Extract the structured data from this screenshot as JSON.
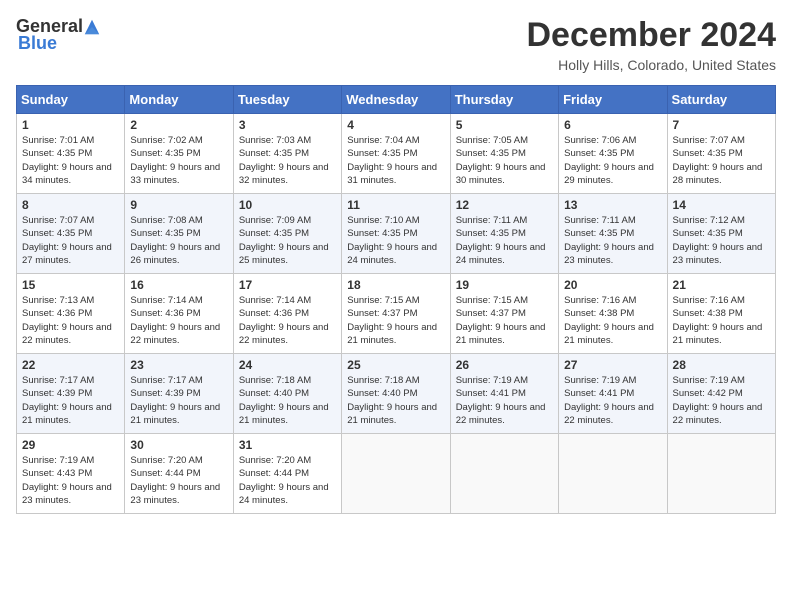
{
  "header": {
    "logo_general": "General",
    "logo_blue": "Blue",
    "month_title": "December 2024",
    "location": "Holly Hills, Colorado, United States"
  },
  "calendar": {
    "days_of_week": [
      "Sunday",
      "Monday",
      "Tuesday",
      "Wednesday",
      "Thursday",
      "Friday",
      "Saturday"
    ],
    "weeks": [
      [
        {
          "day": "1",
          "sunrise": "7:01 AM",
          "sunset": "4:35 PM",
          "daylight": "9 hours and 34 minutes."
        },
        {
          "day": "2",
          "sunrise": "7:02 AM",
          "sunset": "4:35 PM",
          "daylight": "9 hours and 33 minutes."
        },
        {
          "day": "3",
          "sunrise": "7:03 AM",
          "sunset": "4:35 PM",
          "daylight": "9 hours and 32 minutes."
        },
        {
          "day": "4",
          "sunrise": "7:04 AM",
          "sunset": "4:35 PM",
          "daylight": "9 hours and 31 minutes."
        },
        {
          "day": "5",
          "sunrise": "7:05 AM",
          "sunset": "4:35 PM",
          "daylight": "9 hours and 30 minutes."
        },
        {
          "day": "6",
          "sunrise": "7:06 AM",
          "sunset": "4:35 PM",
          "daylight": "9 hours and 29 minutes."
        },
        {
          "day": "7",
          "sunrise": "7:07 AM",
          "sunset": "4:35 PM",
          "daylight": "9 hours and 28 minutes."
        }
      ],
      [
        {
          "day": "8",
          "sunrise": "7:07 AM",
          "sunset": "4:35 PM",
          "daylight": "9 hours and 27 minutes."
        },
        {
          "day": "9",
          "sunrise": "7:08 AM",
          "sunset": "4:35 PM",
          "daylight": "9 hours and 26 minutes."
        },
        {
          "day": "10",
          "sunrise": "7:09 AM",
          "sunset": "4:35 PM",
          "daylight": "9 hours and 25 minutes."
        },
        {
          "day": "11",
          "sunrise": "7:10 AM",
          "sunset": "4:35 PM",
          "daylight": "9 hours and 24 minutes."
        },
        {
          "day": "12",
          "sunrise": "7:11 AM",
          "sunset": "4:35 PM",
          "daylight": "9 hours and 24 minutes."
        },
        {
          "day": "13",
          "sunrise": "7:11 AM",
          "sunset": "4:35 PM",
          "daylight": "9 hours and 23 minutes."
        },
        {
          "day": "14",
          "sunrise": "7:12 AM",
          "sunset": "4:35 PM",
          "daylight": "9 hours and 23 minutes."
        }
      ],
      [
        {
          "day": "15",
          "sunrise": "7:13 AM",
          "sunset": "4:36 PM",
          "daylight": "9 hours and 22 minutes."
        },
        {
          "day": "16",
          "sunrise": "7:14 AM",
          "sunset": "4:36 PM",
          "daylight": "9 hours and 22 minutes."
        },
        {
          "day": "17",
          "sunrise": "7:14 AM",
          "sunset": "4:36 PM",
          "daylight": "9 hours and 22 minutes."
        },
        {
          "day": "18",
          "sunrise": "7:15 AM",
          "sunset": "4:37 PM",
          "daylight": "9 hours and 21 minutes."
        },
        {
          "day": "19",
          "sunrise": "7:15 AM",
          "sunset": "4:37 PM",
          "daylight": "9 hours and 21 minutes."
        },
        {
          "day": "20",
          "sunrise": "7:16 AM",
          "sunset": "4:38 PM",
          "daylight": "9 hours and 21 minutes."
        },
        {
          "day": "21",
          "sunrise": "7:16 AM",
          "sunset": "4:38 PM",
          "daylight": "9 hours and 21 minutes."
        }
      ],
      [
        {
          "day": "22",
          "sunrise": "7:17 AM",
          "sunset": "4:39 PM",
          "daylight": "9 hours and 21 minutes."
        },
        {
          "day": "23",
          "sunrise": "7:17 AM",
          "sunset": "4:39 PM",
          "daylight": "9 hours and 21 minutes."
        },
        {
          "day": "24",
          "sunrise": "7:18 AM",
          "sunset": "4:40 PM",
          "daylight": "9 hours and 21 minutes."
        },
        {
          "day": "25",
          "sunrise": "7:18 AM",
          "sunset": "4:40 PM",
          "daylight": "9 hours and 21 minutes."
        },
        {
          "day": "26",
          "sunrise": "7:19 AM",
          "sunset": "4:41 PM",
          "daylight": "9 hours and 22 minutes."
        },
        {
          "day": "27",
          "sunrise": "7:19 AM",
          "sunset": "4:41 PM",
          "daylight": "9 hours and 22 minutes."
        },
        {
          "day": "28",
          "sunrise": "7:19 AM",
          "sunset": "4:42 PM",
          "daylight": "9 hours and 22 minutes."
        }
      ],
      [
        {
          "day": "29",
          "sunrise": "7:19 AM",
          "sunset": "4:43 PM",
          "daylight": "9 hours and 23 minutes."
        },
        {
          "day": "30",
          "sunrise": "7:20 AM",
          "sunset": "4:44 PM",
          "daylight": "9 hours and 23 minutes."
        },
        {
          "day": "31",
          "sunrise": "7:20 AM",
          "sunset": "4:44 PM",
          "daylight": "9 hours and 24 minutes."
        },
        null,
        null,
        null,
        null
      ]
    ]
  }
}
